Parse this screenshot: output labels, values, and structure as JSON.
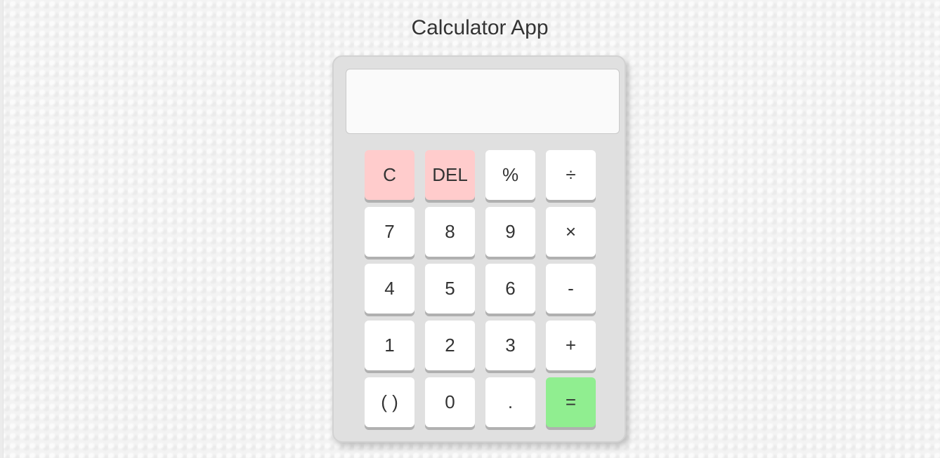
{
  "page": {
    "title": "Calculator App"
  },
  "display": {
    "value": ""
  },
  "colors": {
    "clear_key": "#ffcccc",
    "equals_key": "#90ee90",
    "key": "#ffffff",
    "body": "#e0e0e0"
  },
  "keys": [
    {
      "label": "C",
      "name": "clear-button",
      "type": "clear"
    },
    {
      "label": "DEL",
      "name": "delete-button",
      "type": "clear"
    },
    {
      "label": "%",
      "name": "percent-button",
      "type": "op"
    },
    {
      "label": "÷",
      "name": "divide-button",
      "type": "op"
    },
    {
      "label": "7",
      "name": "digit-7-button",
      "type": "digit"
    },
    {
      "label": "8",
      "name": "digit-8-button",
      "type": "digit"
    },
    {
      "label": "9",
      "name": "digit-9-button",
      "type": "digit"
    },
    {
      "label": "×",
      "name": "multiply-button",
      "type": "op"
    },
    {
      "label": "4",
      "name": "digit-4-button",
      "type": "digit"
    },
    {
      "label": "5",
      "name": "digit-5-button",
      "type": "digit"
    },
    {
      "label": "6",
      "name": "digit-6-button",
      "type": "digit"
    },
    {
      "label": "-",
      "name": "subtract-button",
      "type": "op"
    },
    {
      "label": "1",
      "name": "digit-1-button",
      "type": "digit"
    },
    {
      "label": "2",
      "name": "digit-2-button",
      "type": "digit"
    },
    {
      "label": "3",
      "name": "digit-3-button",
      "type": "digit"
    },
    {
      "label": "+",
      "name": "add-button",
      "type": "op"
    },
    {
      "label": "( )",
      "name": "parentheses-button",
      "type": "op"
    },
    {
      "label": "0",
      "name": "digit-0-button",
      "type": "digit"
    },
    {
      "label": ".",
      "name": "decimal-button",
      "type": "op"
    },
    {
      "label": "=",
      "name": "equals-button",
      "type": "equals"
    }
  ]
}
